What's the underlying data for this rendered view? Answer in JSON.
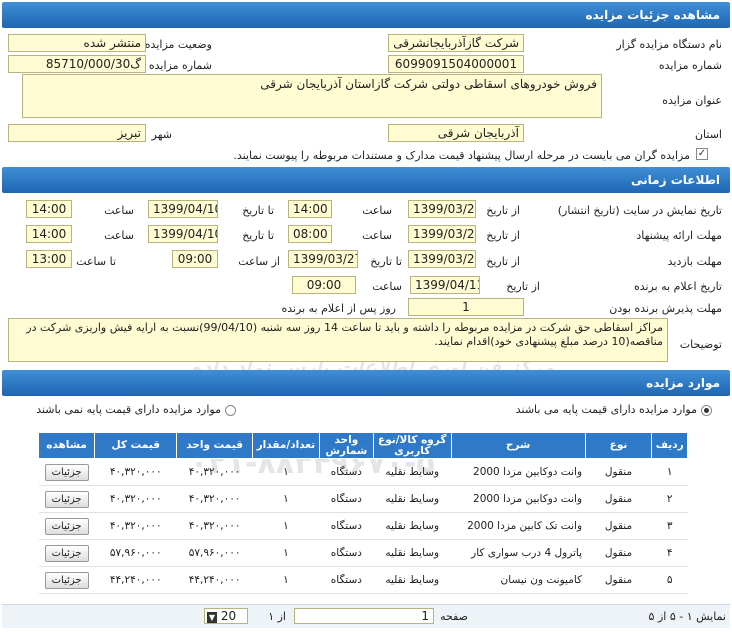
{
  "auction_details": {
    "header": "مشاهده جزئیات مزایده",
    "organizer_label": "نام دستگاه مزایده گزار",
    "organizer_value": "شرکت گازآذربایجانشرقی",
    "status_label": "وضعیت مزایده",
    "status_value": "منتشر شده",
    "number_label": "شماره مزایده",
    "number_value": "6099091504000001",
    "ref_label": "شماره مزایده مرجع",
    "ref_value": "گ85710/000/30",
    "title_label": "عنوان مزایده",
    "title_value": "فروش خودروهای اسقاطی دولتی شرکت گازاستان آذربایجان شرقی",
    "province_label": "استان",
    "province_value": "آذربایجان شرقی",
    "city_label": "شهر",
    "city_value": "تبریز",
    "notice_text": "مزایده گران می بایست در مرحله ارسال پیشنهاد قیمت مدارک و مستندات مربوطه را پیوست نمایند.",
    "notice_checked": true
  },
  "timing": {
    "header": "اطلاعات زمانی",
    "site_display_label": "تاریخ نمایش در سایت (تاریخ انتشار)",
    "offer_deadline_label": "مهلت ارائه پیشنهاد",
    "visit_label": "مهلت بازدید",
    "winner_announce_label": "تاریخ اعلام به برنده",
    "winner_accept_label": "مهلت پذیرش برنده بودن",
    "description_label": "توضیحات",
    "from_date": "از تاریخ",
    "to_date": "تا تاریخ",
    "time": "ساعت",
    "from_time": "از ساعت",
    "to_time": "تا ساعت",
    "site_from_date": "1399/03/20",
    "site_from_time": "14:00",
    "site_to_date": "1399/04/10",
    "site_to_time": "14:00",
    "offer_from_date": "1399/03/28",
    "offer_from_time": "08:00",
    "offer_to_date": "1399/04/10",
    "offer_to_time": "14:00",
    "visit_from_date": "1399/03/20",
    "visit_to_date": "1399/03/27",
    "visit_from_time": "09:00",
    "visit_to_time": "13:00",
    "announce_date": "1399/04/11",
    "announce_time": "09:00",
    "accept_days": "1",
    "accept_suffix": "روز پس از اعلام به برنده",
    "description": "مراکز اسقاطی حق شرکت در مزایده مربوطه را داشته و باید تا ساعت 14 روز سه شنبه (99/04/10)نسبت به ارایه فیش واریزی شرکت در مناقصه(10 درصد مبلغ پیشنهادی خود)اقدام نمایند."
  },
  "items": {
    "header": "موارد مزایده",
    "radio_has_base": "موارد مزایده دارای قیمت پایه می باشند",
    "radio_no_base": "موارد مزایده دارای قیمت پایه نمی باشند",
    "columns": [
      "ردیف",
      "نوع",
      "شرح",
      "گروه کالا/نوع کاربری",
      "واحد شمارش",
      "تعداد/مقدار",
      "قیمت واحد",
      "قیمت کل",
      "مشاهده"
    ],
    "rows": [
      {
        "row": "۱",
        "type": "منقول",
        "desc": "وانت دوکابین مزدا 2000",
        "group": "وسایط نقلیه",
        "unit": "دستگاه",
        "qty": "۱",
        "unit_price": "۴۰,۳۲۰,۰۰۰",
        "total": "۴۰,۳۲۰,۰۰۰",
        "view": "جزئیات"
      },
      {
        "row": "۲",
        "type": "منقول",
        "desc": "وانت دوکابین مزدا 2000",
        "group": "وسایط نقلیه",
        "unit": "دستگاه",
        "qty": "۱",
        "unit_price": "۴۰,۳۲۰,۰۰۰",
        "total": "۴۰,۳۲۰,۰۰۰",
        "view": "جزئیات"
      },
      {
        "row": "۳",
        "type": "منقول",
        "desc": "وانت تک کابین مزدا 2000",
        "group": "وسایط نقلیه",
        "unit": "دستگاه",
        "qty": "۱",
        "unit_price": "۴۰,۳۲۰,۰۰۰",
        "total": "۴۰,۳۲۰,۰۰۰",
        "view": "جزئیات"
      },
      {
        "row": "۴",
        "type": "منقول",
        "desc": "پاترول 4 درب سواری کار",
        "group": "وسایط نقلیه",
        "unit": "دستگاه",
        "qty": "۱",
        "unit_price": "۵۷,۹۶۰,۰۰۰",
        "total": "۵۷,۹۶۰,۰۰۰",
        "view": "جزئیات"
      },
      {
        "row": "۵",
        "type": "منقول",
        "desc": "کامیونت ون نیسان",
        "group": "وسایط نقلیه",
        "unit": "دستگاه",
        "qty": "۱",
        "unit_price": "۴۴,۲۴۰,۰۰۰",
        "total": "۴۴,۲۴۰,۰۰۰",
        "view": "جزئیات"
      }
    ]
  },
  "pager": {
    "display": "نمایش ۱ - ۵ از ۵",
    "page_label": "صفحه",
    "page_value": "1",
    "of": "از ۱",
    "page_size": "20"
  },
  "watermark": {
    "brand": "ParsNamadData",
    "fa": "مرکز فن آوری اطلاعات پارس نماد داده",
    "phone": "۰۲۱-۸۸۳۴۹۶۷۰-۵"
  },
  "colors": {
    "header_blue": "#2f79c6",
    "field_yellow": "#fffbd2"
  }
}
